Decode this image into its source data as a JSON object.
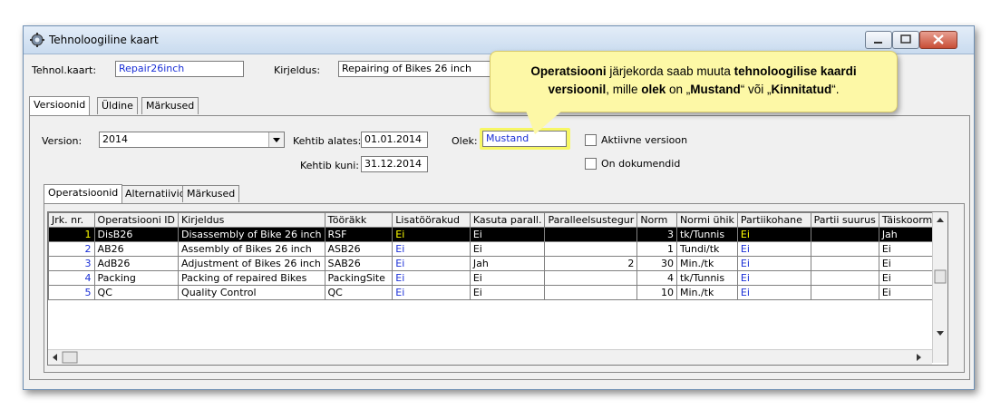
{
  "window": {
    "title": "Tehnoloogiline kaart",
    "buttons": [
      "minimize",
      "maximize",
      "close"
    ]
  },
  "header": {
    "card_label": "Tehnol.kaart:",
    "card_value": "Repair26inch",
    "description_label": "Kirjeldus:",
    "description_value": "Repairing of Bikes 26 inch"
  },
  "top_tabs": [
    {
      "label": "Versioonid",
      "active": true
    },
    {
      "label": "Üldine",
      "active": false
    },
    {
      "label": "Märkused",
      "active": false
    }
  ],
  "version": {
    "version_label": "Version:",
    "version_value": "2014",
    "valid_from_label": "Kehtib alates:",
    "valid_from_value": "01.01.2014",
    "valid_to_label": "Kehtib kuni:",
    "valid_to_value": "31.12.2014",
    "status_label": "Olek:",
    "status_value": "Mustand",
    "active_version_label": "Aktiivne versioon",
    "has_documents_label": "On dokumendid"
  },
  "inner_tabs": [
    {
      "label": "Operatsioonid",
      "active": true
    },
    {
      "label": "Alternatiivid",
      "active": false
    },
    {
      "label": "Märkused",
      "active": false
    }
  ],
  "table": {
    "columns": [
      "Jrk. nr.",
      "Operatsiooni ID",
      "Kirjeldus",
      "Tööräkk",
      "Lisatöörakud",
      "Kasuta parall.",
      "Paralleelsustegur",
      "Norm",
      "Normi ühik",
      "Partiikohane",
      "Partii suurus",
      "Täiskoormus"
    ],
    "rows": [
      [
        "1",
        "DisB26",
        "Disassembly of Bike 26 inch",
        "RSF",
        "Ei",
        "Ei",
        "",
        "3",
        "tk/Tunnis",
        "Ei",
        "",
        "Jah"
      ],
      [
        "2",
        "AB26",
        "Assembly of Bikes 26 inch",
        "ASB26",
        "Ei",
        "Ei",
        "",
        "1",
        "Tundi/tk",
        "Ei",
        "",
        "Ei"
      ],
      [
        "3",
        "AdB26",
        "Adjustment of Bikes 26 inch",
        "SAB26",
        "Ei",
        "Jah",
        "2",
        "30",
        "Min./tk",
        "Ei",
        "",
        "Ei"
      ],
      [
        "4",
        "Packing",
        "Packing of repaired Bikes",
        "PackingSite",
        "Ei",
        "Ei",
        "",
        "4",
        "tk/Tunnis",
        "Ei",
        "",
        "Ei"
      ],
      [
        "5",
        "QC",
        "Quality Control",
        "QC",
        "Ei",
        "Ei",
        "",
        "10",
        "Min./tk",
        "Ei",
        "",
        "Ei"
      ]
    ],
    "selected_row": 0
  },
  "callout": {
    "part1": "Operatsiooni",
    "part2": " järjekorda saab muuta ",
    "part3": "tehnoloogilise kaardi versioonil",
    "part4": ", mille ",
    "part5": "olek",
    "part6": " on „",
    "part7": "Mustand",
    "part8": "“ või „",
    "part9": "Kinnitatud",
    "part10": "“."
  },
  "colors": {
    "link_blue": "#1a2fd6",
    "selection_bg": "#000000",
    "selection_highlight": "#ffff00",
    "callout_bg": "#fdf8a6"
  }
}
